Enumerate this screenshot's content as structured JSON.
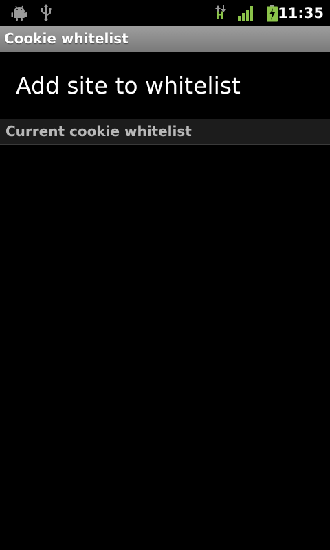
{
  "status_bar": {
    "left_icons": [
      "android-debug-icon",
      "usb-icon"
    ],
    "network_type": "H",
    "right_icons": [
      "data-activity-icon",
      "signal-strength-icon",
      "battery-charging-icon"
    ],
    "time": "11:35",
    "accent_color": "#8bc34a"
  },
  "title_bar": {
    "title": "Cookie whitelist"
  },
  "preferences": {
    "add_site_label": "Add site to whitelist"
  },
  "whitelist_section": {
    "header": "Current cookie whitelist",
    "items": []
  }
}
